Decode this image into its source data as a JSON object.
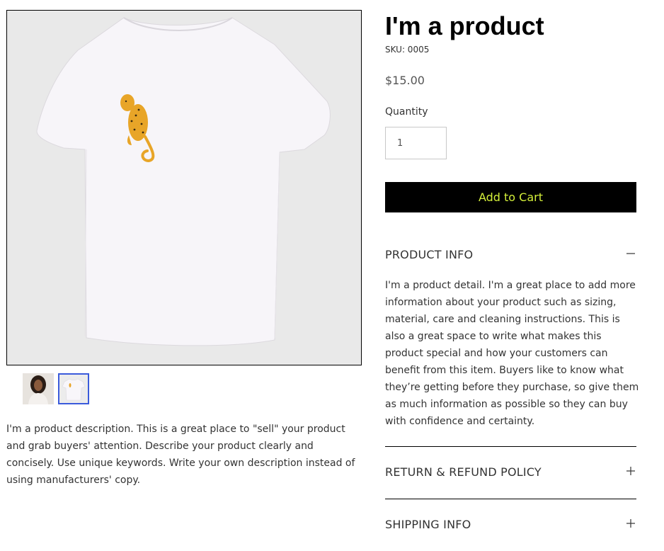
{
  "product": {
    "title": "I'm a product",
    "sku": "SKU: 0005",
    "price": "$15.00",
    "quantity_label": "Quantity",
    "quantity_value": "1",
    "add_to_cart_label": "Add to Cart",
    "description": "I'm a product description. This is a great place to \"sell\" your product and grab buyers' attention. Describe your product clearly and concisely. Use unique keywords. Write your own description instead of using manufacturers' copy."
  },
  "gallery": {
    "main_image": "white-tshirt-with-cheetah-print",
    "thumbnails": [
      {
        "image": "model-wearing-shirt",
        "selected": false
      },
      {
        "image": "white-tshirt-with-cheetah-print",
        "selected": true
      }
    ]
  },
  "accordion": [
    {
      "title": "PRODUCT INFO",
      "expanded": true,
      "icon": "minus-icon",
      "body": "I'm a product detail. I'm a great place to add more information about your product such as sizing, material, care and cleaning instructions. This is also a great space to write what makes this product special and how your customers can benefit from this item. Buyers like to know what they’re getting before they purchase, so give them as much information as possible so they can buy with confidence and certainty."
    },
    {
      "title": "RETURN & REFUND POLICY",
      "expanded": false,
      "icon": "plus-icon"
    },
    {
      "title": "SHIPPING INFO",
      "expanded": false,
      "icon": "plus-icon"
    }
  ],
  "colors": {
    "button_bg": "#000000",
    "button_text": "#d4ef3a",
    "thumbnail_selected_border": "#3b5bdb"
  }
}
